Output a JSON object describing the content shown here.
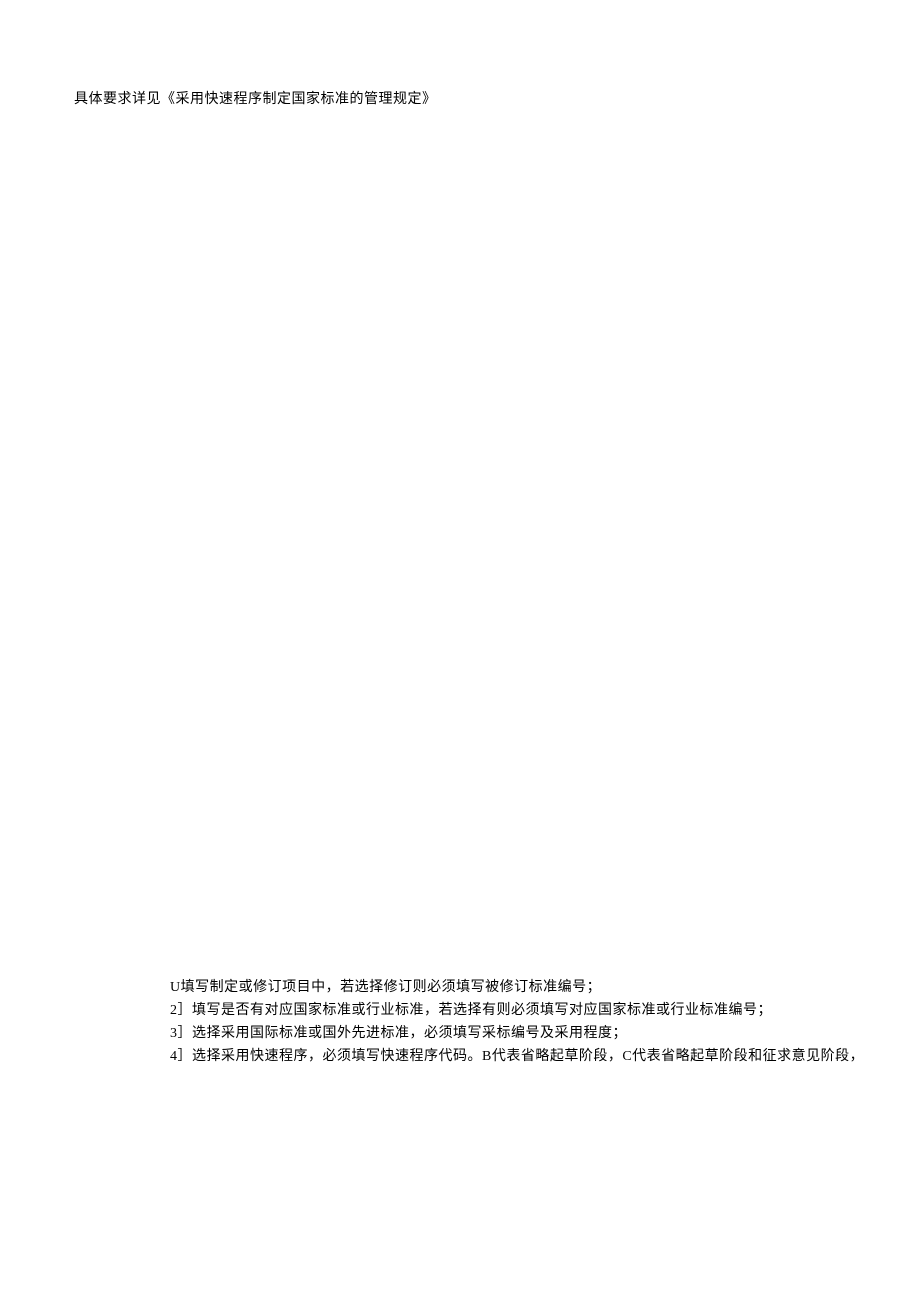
{
  "topLine": "具体要求详见《采用快速程序制定国家标准的管理规定》",
  "notes": {
    "line1": "U填写制定或修订项目中，若选择修订则必须填写被修订标准编号；",
    "line2": "2］填写是否有对应国家标准或行业标准，若选择有则必须填写对应国家标准或行业标准编号；",
    "line3": "3］选择采用国际标准或国外先进标准，必须填写采标编号及采用程度；",
    "line4": "4］选择采用快速程序，必须填写快速程序代码。B代表省略起草阶段，C代表省略起草阶段和征求意见阶段，"
  }
}
